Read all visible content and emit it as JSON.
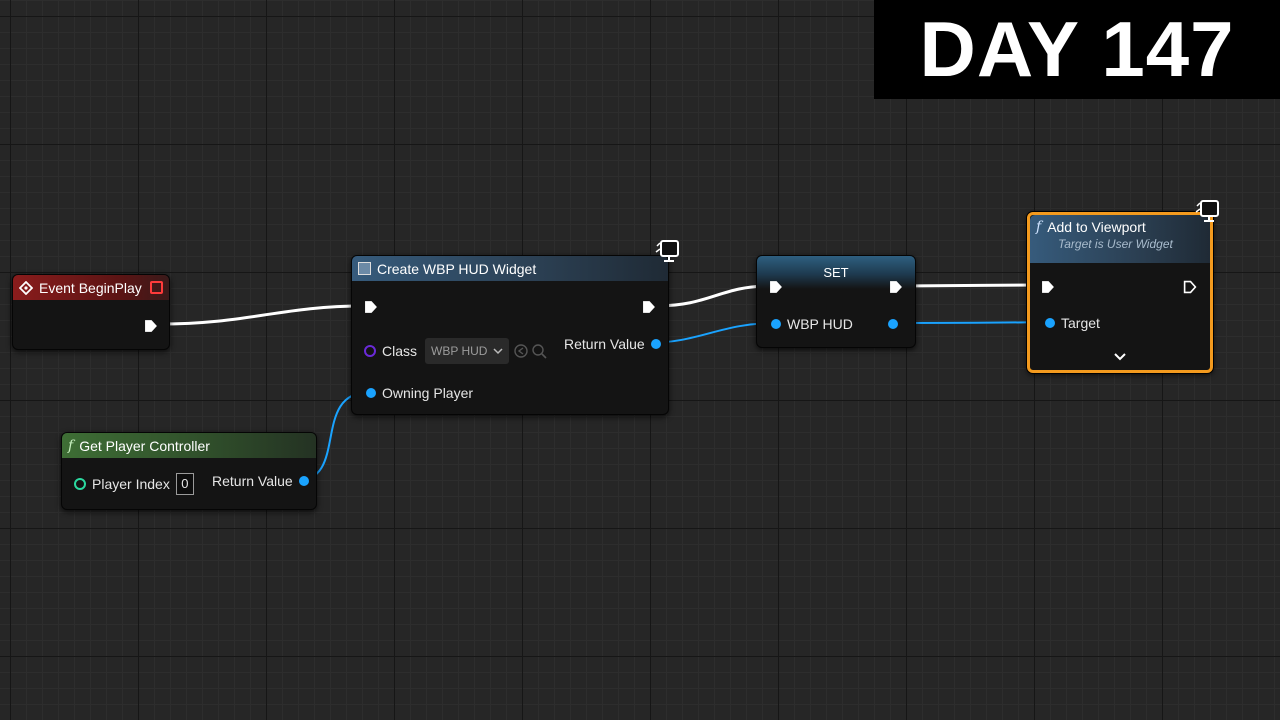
{
  "banner": {
    "text": "DAY 147"
  },
  "nodes": {
    "event_beginplay": {
      "title": "Event BeginPlay"
    },
    "create_widget": {
      "title": "Create WBP HUD Widget",
      "class_label": "Class",
      "class_value": "WBP HUD",
      "return_label": "Return Value",
      "owning_label": "Owning Player"
    },
    "set_node": {
      "title": "SET",
      "var_label": "WBP HUD"
    },
    "add_viewport": {
      "title": "Add to Viewport",
      "subtitle": "Target is User Widget",
      "target_label": "Target"
    },
    "get_player_controller": {
      "title": "Get Player Controller",
      "player_index_label": "Player Index",
      "player_index_value": "0",
      "return_label": "Return Value"
    }
  },
  "colors": {
    "exec_wire": "#ffffff",
    "object_wire": "#1aa3ff",
    "event_header": "#8a1c1c",
    "function_header": "#365b7c",
    "pure_header": "#3e6e35",
    "selection": "#f39a1e"
  }
}
